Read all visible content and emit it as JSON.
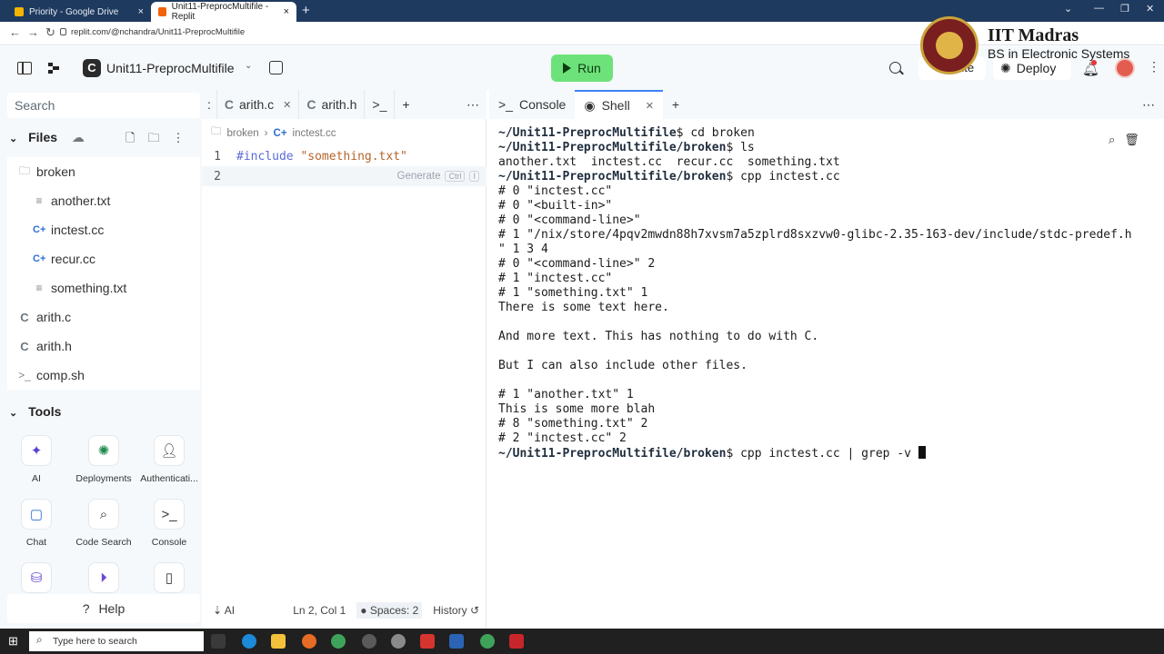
{
  "browser": {
    "tabs": [
      {
        "title": "Priority - Google Drive",
        "close": "×"
      },
      {
        "title": "Unit11-PreprocMultifile - Replit",
        "close": "×"
      }
    ],
    "new_tab": "+",
    "url": "replit.com/@nchandra/Unit11-PreprocMultifile"
  },
  "header": {
    "project_icon": "C",
    "project_name": "Unit11-PreprocMultifile",
    "run_label": "Run",
    "invite_label": "Invite",
    "deploy_label": "Deploy"
  },
  "watermark": {
    "title": "IIT Madras",
    "subtitle": "BS in Electronic Systems"
  },
  "sidebar": {
    "search_placeholder": "Search",
    "files_title": "Files",
    "files": [
      {
        "name": "broken",
        "type": "folder"
      },
      {
        "name": "another.txt",
        "type": "text"
      },
      {
        "name": "inctest.cc",
        "type": "cpp"
      },
      {
        "name": "recur.cc",
        "type": "cpp"
      },
      {
        "name": "something.txt",
        "type": "text"
      },
      {
        "name": "arith.c",
        "type": "c"
      },
      {
        "name": "arith.h",
        "type": "c"
      },
      {
        "name": "comp.sh",
        "type": "shell"
      }
    ],
    "tools_title": "Tools",
    "tools": [
      "AI",
      "Deployments",
      "Authenticati...",
      "Chat",
      "Code Search",
      "Console"
    ],
    "help_label": "Help"
  },
  "editor": {
    "tabs": [
      {
        "label": "arith.c"
      },
      {
        "label": "arith.h"
      }
    ],
    "breadcrumb_folder": "broken",
    "breadcrumb_file": "inctest.cc",
    "lines": [
      {
        "num": "1",
        "text": "#include \"something.txt\""
      },
      {
        "num": "2",
        "text": ""
      }
    ],
    "generate_label": "Generate",
    "generate_kbd1": "Ctrl",
    "generate_kbd2": "I",
    "status": {
      "ai": "AI",
      "cursor": "Ln 2, Col 1",
      "spaces": "Spaces: 2",
      "history": "History"
    }
  },
  "right_panel": {
    "tabs": [
      {
        "label": "Console"
      },
      {
        "label": "Shell"
      }
    ],
    "add_tab": "+",
    "terminal_lines": [
      {
        "prompt": "~/Unit11-PreprocMultifile",
        "text": "$ cd broken"
      },
      {
        "prompt": "~/Unit11-PreprocMultifile/broken",
        "text": "$ ls"
      },
      {
        "prompt": "",
        "text": "another.txt  inctest.cc  recur.cc  something.txt"
      },
      {
        "prompt": "~/Unit11-PreprocMultifile/broken",
        "text": "$ cpp inctest.cc"
      },
      {
        "prompt": "",
        "text": "# 0 \"inctest.cc\""
      },
      {
        "prompt": "",
        "text": "# 0 \"<built-in>\""
      },
      {
        "prompt": "",
        "text": "# 0 \"<command-line>\""
      },
      {
        "prompt": "",
        "text": "# 1 \"/nix/store/4pqv2mwdn88h7xvsm7a5zplrd8sxzvw0-glibc-2.35-163-dev/include/stdc-predef.h"
      },
      {
        "prompt": "",
        "text": "\" 1 3 4"
      },
      {
        "prompt": "",
        "text": "# 0 \"<command-line>\" 2"
      },
      {
        "prompt": "",
        "text": "# 1 \"inctest.cc\""
      },
      {
        "prompt": "",
        "text": "# 1 \"something.txt\" 1"
      },
      {
        "prompt": "",
        "text": "There is some text here."
      },
      {
        "prompt": "",
        "text": ""
      },
      {
        "prompt": "",
        "text": "And more text. This has nothing to do with C."
      },
      {
        "prompt": "",
        "text": ""
      },
      {
        "prompt": "",
        "text": "But I can also include other files."
      },
      {
        "prompt": "",
        "text": ""
      },
      {
        "prompt": "",
        "text": "# 1 \"another.txt\" 1"
      },
      {
        "prompt": "",
        "text": "This is some more blah"
      },
      {
        "prompt": "",
        "text": "# 8 \"something.txt\" 2"
      },
      {
        "prompt": "",
        "text": "# 2 \"inctest.cc\" 2"
      },
      {
        "prompt": "~/Unit11-PreprocMultifile/broken",
        "text": "$ cpp inctest.cc | grep -v "
      }
    ]
  },
  "taskbar": {
    "search_placeholder": "Type here to search"
  }
}
